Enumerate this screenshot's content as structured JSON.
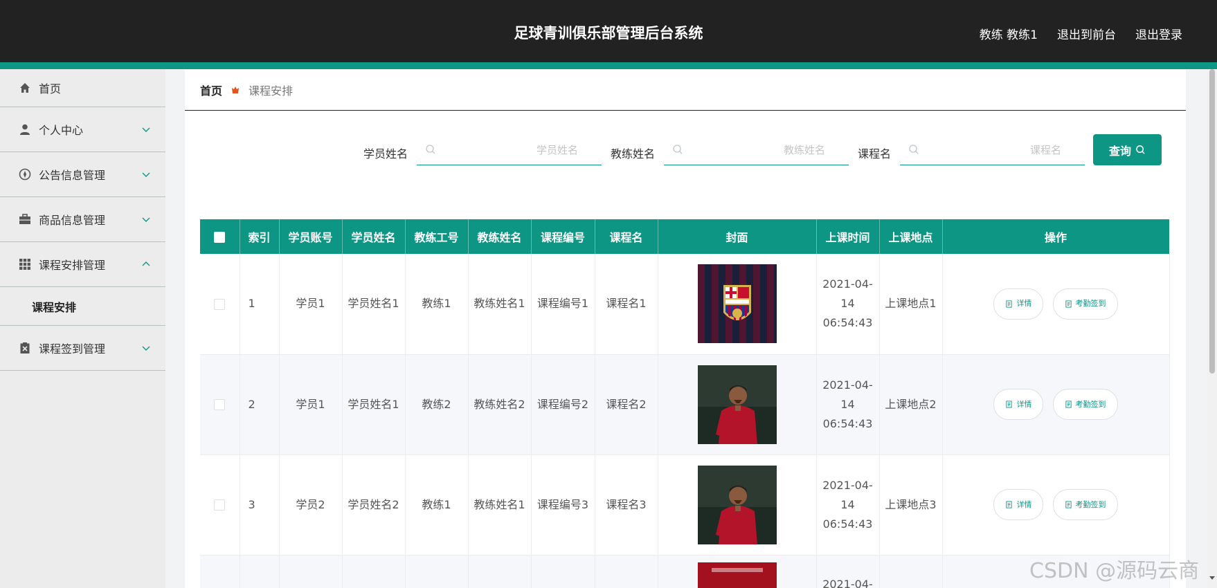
{
  "header": {
    "title": "足球青训俱乐部管理后台系统",
    "user": "教练 教练1",
    "to_front": "退出到前台",
    "logout": "退出登录"
  },
  "colors": {
    "primary": "#0e9684",
    "header_bg": "#222222",
    "sidebar_bg": "#ececec"
  },
  "sidebar": {
    "items": [
      {
        "label": "首页",
        "icon": "home-icon"
      },
      {
        "label": "个人中心",
        "icon": "user-icon"
      },
      {
        "label": "公告信息管理",
        "icon": "compass-icon"
      },
      {
        "label": "商品信息管理",
        "icon": "briefcase-icon"
      },
      {
        "label": "课程安排管理",
        "icon": "grid-icon"
      },
      {
        "label": "课程签到管理",
        "icon": "clipboard-icon"
      }
    ],
    "sub_item": "课程安排"
  },
  "breadcrumb": {
    "home": "首页",
    "current": "课程安排"
  },
  "search": {
    "student_label": "学员姓名",
    "student_placeholder": "学员姓名",
    "coach_label": "教练姓名",
    "coach_placeholder": "教练姓名",
    "course_label": "课程名",
    "course_placeholder": "课程名",
    "query_label": "查询"
  },
  "table": {
    "columns": [
      "索引",
      "学员账号",
      "学员姓名",
      "教练工号",
      "教练姓名",
      "课程编号",
      "课程名",
      "封面",
      "上课时间",
      "上课地点",
      "操作"
    ],
    "detail_label": "详情",
    "signin_label": "考勤签到",
    "rows": [
      {
        "idx": "1",
        "account": "学员1",
        "student": "学员姓名1",
        "coach_no": "教练1",
        "coach": "教练姓名1",
        "course_no": "课程编号1",
        "course": "课程名1",
        "time": "2021-04-14 06:54:43",
        "place": "上课地点1",
        "cover": "fcb-crest"
      },
      {
        "idx": "2",
        "account": "学员1",
        "student": "学员姓名1",
        "coach_no": "教练2",
        "coach": "教练姓名2",
        "course_no": "课程编号2",
        "course": "课程名2",
        "time": "2021-04-14 06:54:43",
        "place": "上课地点2",
        "cover": "player-red"
      },
      {
        "idx": "3",
        "account": "学员2",
        "student": "学员姓名2",
        "coach_no": "教练1",
        "coach": "教练姓名1",
        "course_no": "课程编号3",
        "course": "课程名3",
        "time": "2021-04-14 06:54:43",
        "place": "上课地点3",
        "cover": "player-red"
      },
      {
        "time_partial": "2021-04-"
      }
    ]
  },
  "watermark": "CSDN @源码云商"
}
